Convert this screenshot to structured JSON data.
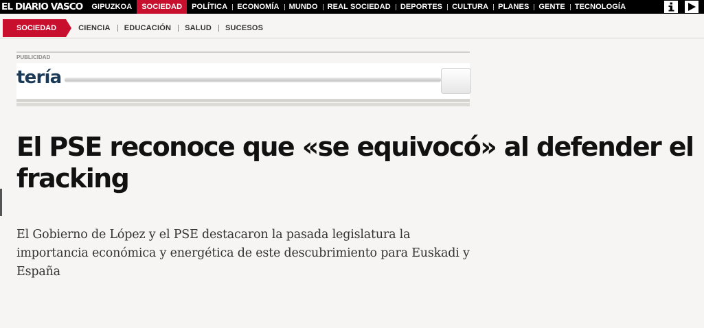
{
  "brand": {
    "logo_text": "EL DIARIO VASCO"
  },
  "top_nav": {
    "items": [
      {
        "label": "GIPUZKOA",
        "active": false
      },
      {
        "label": "SOCIEDAD",
        "active": true
      },
      {
        "label": "POLÍTICA",
        "active": false
      },
      {
        "label": "ECONOMÍA",
        "active": false
      },
      {
        "label": "MUNDO",
        "active": false
      },
      {
        "label": "REAL SOCIEDAD",
        "active": false
      },
      {
        "label": "DEPORTES",
        "active": false
      },
      {
        "label": "CULTURA",
        "active": false
      },
      {
        "label": "PLANES",
        "active": false
      },
      {
        "label": "GENTE",
        "active": false
      },
      {
        "label": "TECNOLOGÍA",
        "active": false
      }
    ],
    "icons": [
      "info-icon",
      "play-icon"
    ]
  },
  "sub_nav": {
    "active_label": "SOCIEDAD",
    "items": [
      "CIENCIA",
      "EDUCACIÓN",
      "SALUD",
      "SUCESOS"
    ]
  },
  "ad": {
    "label": "PUBLICIDAD",
    "banner_text": "tería"
  },
  "article": {
    "headline": "El PSE reconoce que «se equivocó» al defender el fracking",
    "subheadline": "El Gobierno de López y el PSE destacaron la pasada legislatura la importancia económica y energética de este descubrimiento para Euskadi y España"
  },
  "colors": {
    "accent": "#c8102e",
    "nav_background": "#000000",
    "page_background": "#f6f5f3",
    "ad_text": "#1b3a57"
  }
}
